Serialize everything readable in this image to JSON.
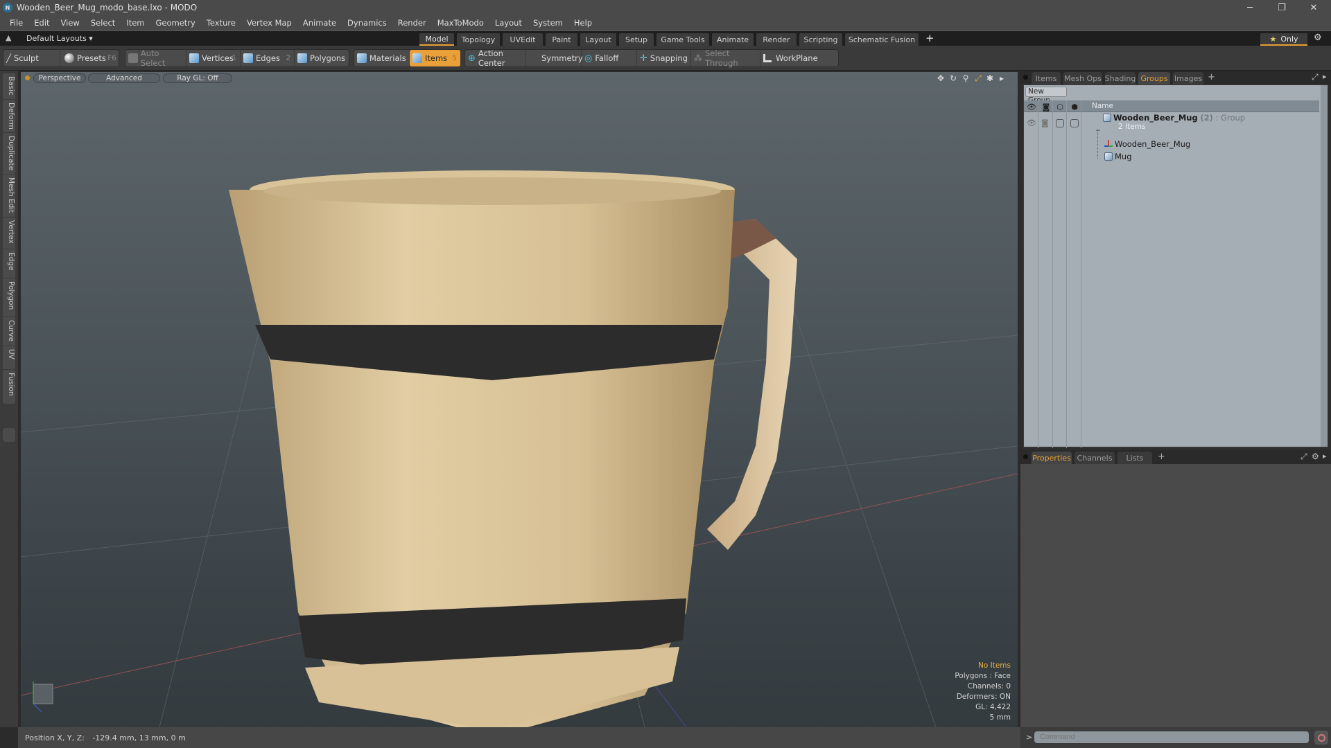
{
  "window": {
    "title": "Wooden_Beer_Mug_modo_base.lxo - MODO",
    "controls": {
      "minimize": "─",
      "restore": "❐",
      "close": "✕"
    }
  },
  "menu": [
    "File",
    "Edit",
    "View",
    "Select",
    "Item",
    "Geometry",
    "Texture",
    "Vertex Map",
    "Animate",
    "Dynamics",
    "Render",
    "MaxToModo",
    "Layout",
    "System",
    "Help"
  ],
  "layoutbar": {
    "layouts_dropdown": "Default Layouts ▾",
    "tabs": [
      "Model",
      "Topology",
      "UVEdit",
      "Paint",
      "Layout",
      "Setup",
      "Game Tools",
      "Animate",
      "Render",
      "Scripting",
      "Schematic Fusion"
    ],
    "active_tab": "Model",
    "add_tab": "+",
    "only_button": "Only",
    "star_icon": "★",
    "gear_icon": "⚙"
  },
  "toolbar": {
    "sculpt": "Sculpt",
    "presets": "Presets",
    "presets_key": "F6",
    "auto_select": "Auto Select",
    "vertices": "Vertices",
    "vertices_key": "1",
    "edges": "Edges",
    "edges_key": "2",
    "polygons": "Polygons",
    "materials": "Materials",
    "items": "Items",
    "items_key": "5",
    "action_center": "Action Center",
    "symmetry": "Symmetry",
    "falloff": "Falloff",
    "snapping": "Snapping",
    "select_through": "Select Through",
    "workplane": "WorkPlane"
  },
  "left_tabs": [
    "Basic",
    "Deform",
    "Duplicate",
    "Mesh Edit",
    "Vertex",
    "Edge",
    "Polygon",
    "Curve",
    "UV",
    "Fusion"
  ],
  "viewport": {
    "view_mode": "Perspective",
    "shading": "Advanced",
    "raygl": "Ray GL: Off",
    "stats": {
      "items": "No Items",
      "polygons": "Polygons : Face",
      "channels": "Channels: 0",
      "deformers": "Deformers: ON",
      "gl": "GL: 4,422",
      "scale": "5 mm"
    }
  },
  "scene_panel": {
    "tabs": [
      "Items",
      "Mesh Ops",
      "Shading",
      "Groups",
      "Images"
    ],
    "active_tab": "Groups",
    "add_tab": "+",
    "new_group": "New Group",
    "column_name": "Name",
    "group": {
      "name": "Wooden_Beer_Mug",
      "count": "(2)",
      "type": ": Group",
      "sub": "2 Items"
    },
    "children": [
      {
        "name": "Wooden_Beer_Mug",
        "icon": "locator-icon"
      },
      {
        "name": "Mug",
        "icon": "mesh-icon"
      }
    ]
  },
  "props_panel": {
    "tabs": [
      "Properties",
      "Channels",
      "Lists"
    ],
    "active_tab": "Properties",
    "add_tab": "+"
  },
  "statusbar": {
    "position_label": "Position X, Y, Z:",
    "position_value": "-129.4 mm, 13 mm, 0 m"
  },
  "command": {
    "prompt": ">",
    "placeholder": "Command"
  }
}
